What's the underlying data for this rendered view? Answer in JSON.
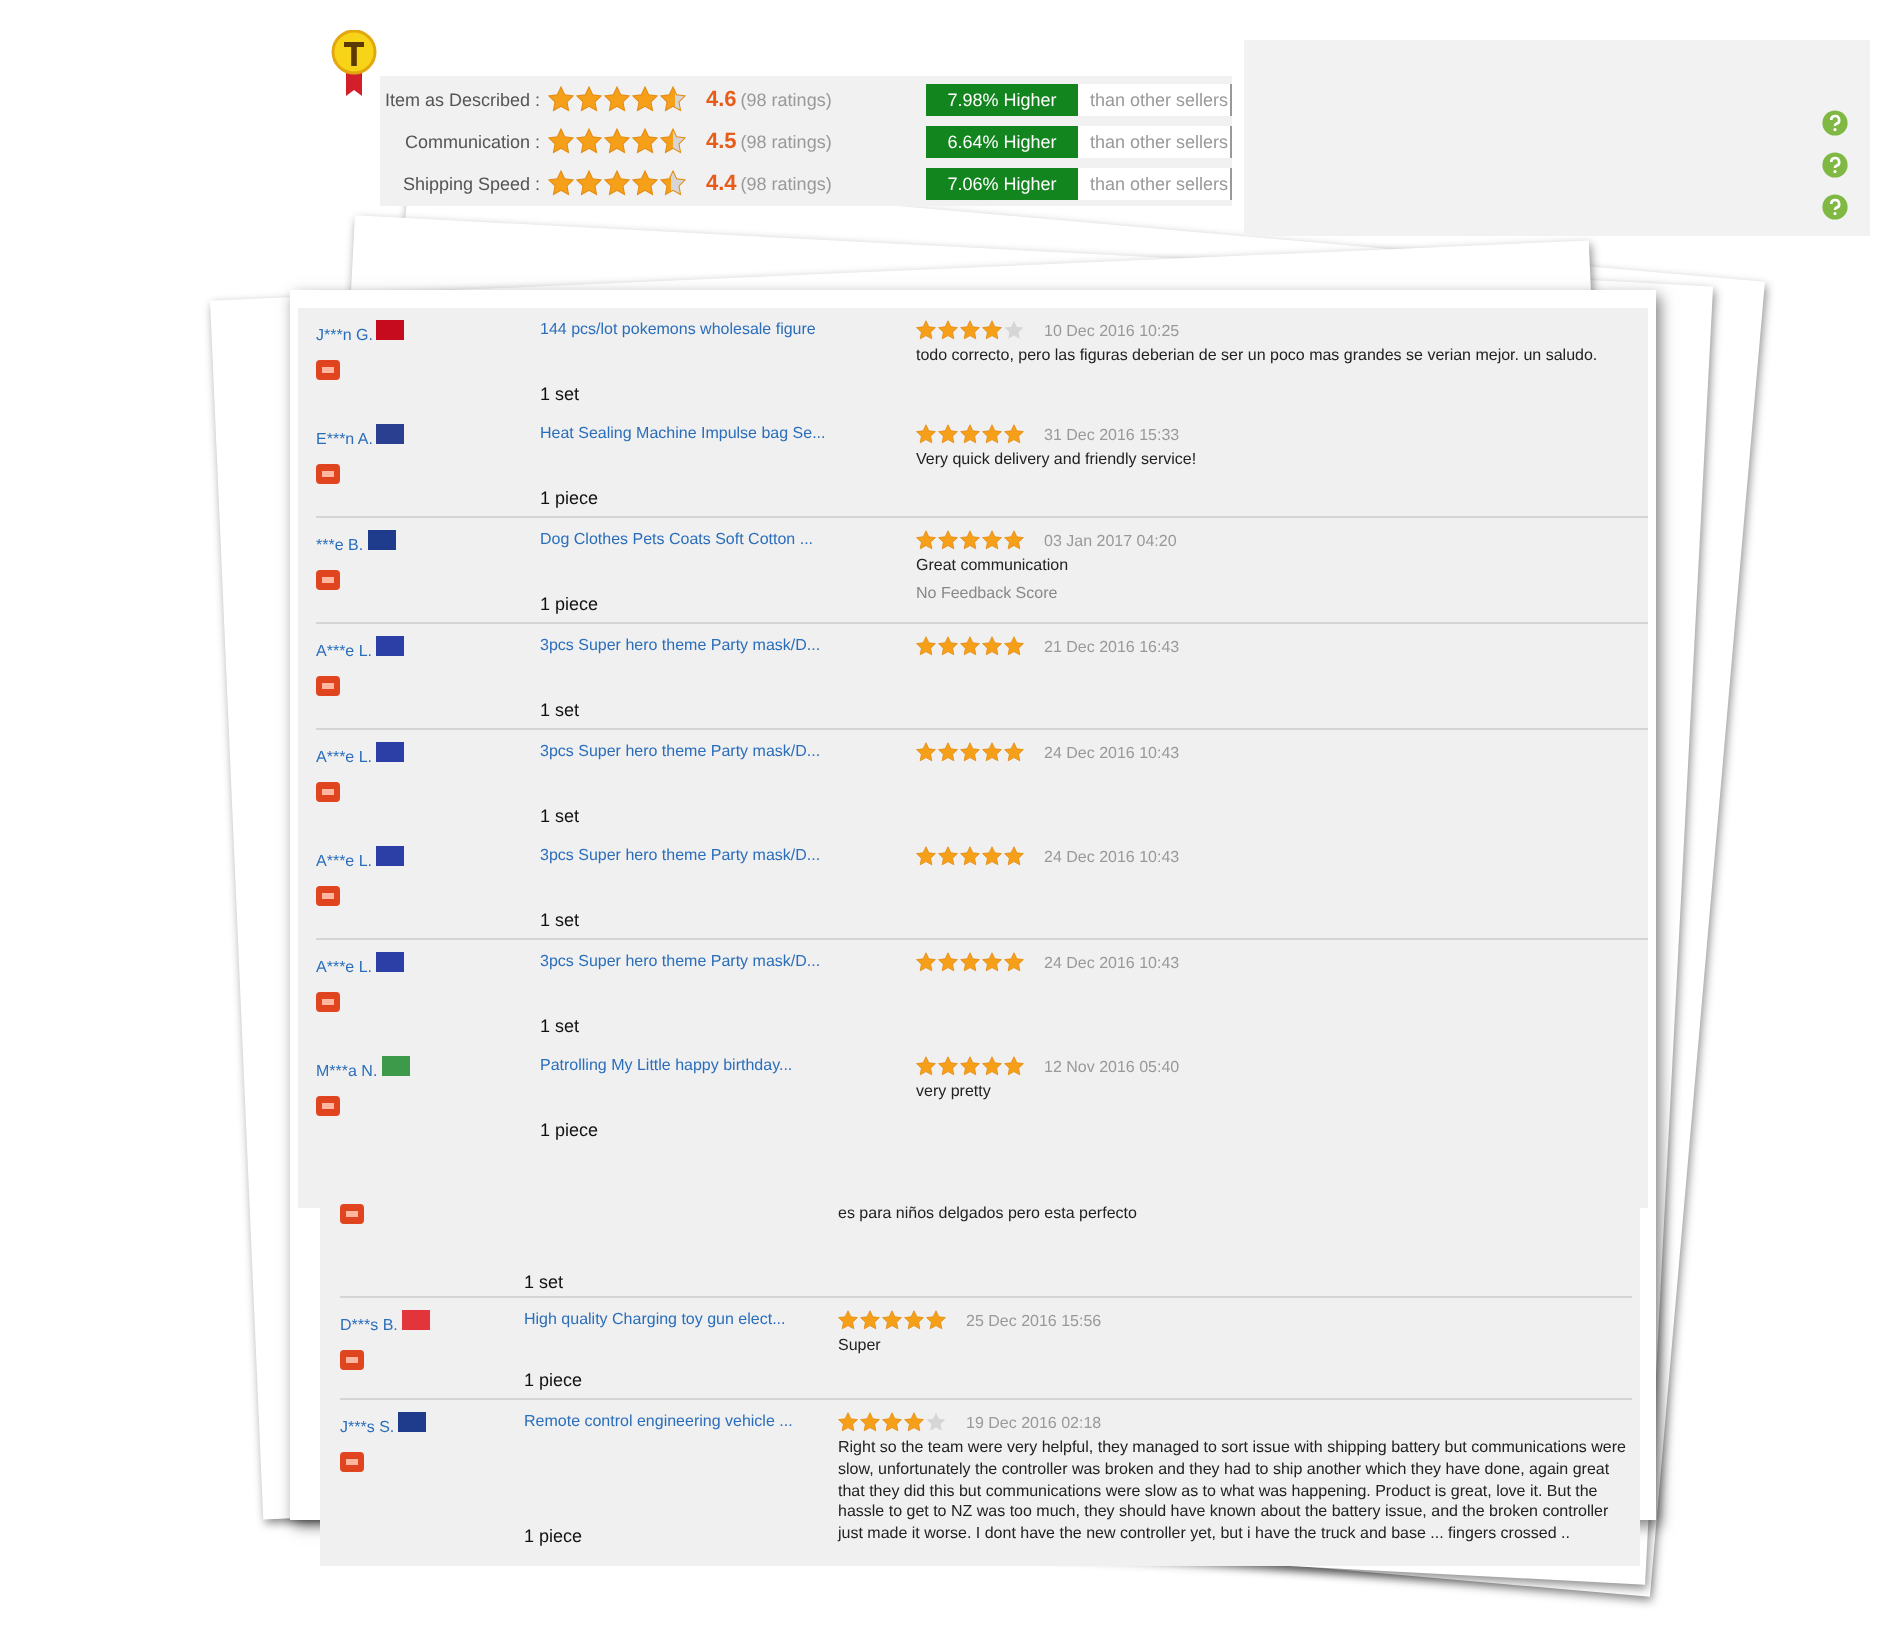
{
  "summary": {
    "ratings": [
      {
        "label": "Item as Described :",
        "stars": 4.6,
        "score": "4.6",
        "count": "(98 ratings)",
        "comparison": "7.98% Higher",
        "suffix": "than other sellers"
      },
      {
        "label": "Communication :",
        "stars": 4.5,
        "score": "4.5",
        "count": "(98 ratings)",
        "comparison": "6.64% Higher",
        "suffix": "than other sellers"
      },
      {
        "label": "Shipping Speed :",
        "stars": 4.4,
        "score": "4.4",
        "count": "(98 ratings)",
        "comparison": "7.06% Higher",
        "suffix": "than other sellers"
      }
    ]
  },
  "feedback_groups": [
    [
      {
        "kind": "full",
        "buyer": "J***n G.",
        "color": "#c60b1e",
        "product": "144 pcs/lot pokemons wholesale figure",
        "quantity": "1 set",
        "stars": 4,
        "date": "10 Dec 2016 10:25",
        "comment": "todo correcto, pero las figuras deberian de ser un poco mas grandes se verian mejor. un saludo."
      },
      {
        "kind": "full",
        "buyer": "E***n A.",
        "color": "#2a3f8f",
        "product": "Heat Sealing Machine Impulse bag Se...",
        "quantity": "1 piece",
        "stars": 5,
        "date": "31 Dec 2016 15:33",
        "comment": "Very quick delivery and friendly service!"
      }
    ],
    [
      {
        "kind": "full",
        "buyer": "***e B.",
        "color": "#1f3c8c",
        "product": "Dog Clothes Pets Coats Soft Cotton ...",
        "quantity": "1 piece",
        "stars": 5,
        "date": "03 Jan 2017 04:20",
        "comment": "Great communication",
        "note": "No Feedback Score"
      }
    ],
    [
      {
        "kind": "full",
        "buyer": "A***e L.",
        "color": "#2b3fa6",
        "product": "3pcs Super hero theme Party mask/D...",
        "quantity": "1 set",
        "stars": 5,
        "date": "21 Dec 2016 16:43"
      }
    ],
    [
      {
        "kind": "full",
        "buyer": "A***e L.",
        "color": "#2b3fa6",
        "product": "3pcs Super hero theme Party mask/D...",
        "quantity": "1 set",
        "stars": 5,
        "date": "24 Dec 2016 10:43"
      },
      {
        "kind": "full",
        "buyer": "A***e L.",
        "color": "#2b3fa6",
        "product": "3pcs Super hero theme Party mask/D...",
        "quantity": "1 set",
        "stars": 5,
        "date": "24 Dec 2016 10:43"
      }
    ],
    [
      {
        "kind": "full",
        "buyer": "A***e L.",
        "color": "#2b3fa6",
        "product": "3pcs Super hero theme Party mask/D...",
        "quantity": "1 set",
        "stars": 5,
        "date": "24 Dec 2016 10:43"
      },
      {
        "kind": "full",
        "buyer": "M***a N.",
        "color": "#3d9a4b",
        "product": "Patrolling My Little happy birthday...",
        "quantity": "1 piece",
        "stars": 5,
        "date": "12 Nov 2016 05:40",
        "comment": "very pretty"
      }
    ]
  ],
  "lower_feedback_groups": [
    [
      {
        "kind": "partial",
        "comment": "es para niños delgados pero esta perfecto",
        "quantity": "1 set"
      }
    ],
    [
      {
        "kind": "full",
        "buyer": "D***s B.",
        "color": "#e3333b",
        "product": "High quality Charging toy gun elect...",
        "quantity": "1 piece",
        "stars": 5,
        "date": "25 Dec 2016 15:56",
        "comment": "Super"
      }
    ],
    [
      {
        "kind": "full",
        "buyer": "J***s S.",
        "color": "#1f3c8c",
        "product": "Remote control engineering vehicle ...",
        "quantity": "1 piece",
        "stars": 4,
        "date": "19 Dec 2016 02:18",
        "comment": "Right so the team were very helpful, they managed to sort issue with shipping battery but communications were slow, unfortunately the controller was broken and they had to ship another which they have done, again great that they did this but communications were slow as to what was happening. Product is great, love it. But the hassle to get to NZ was too much, they should have known about the battery issue, and the broken controller just made it worse. I dont have the new controller yet, but i have the truck and base ... fingers crossed .."
      }
    ]
  ]
}
